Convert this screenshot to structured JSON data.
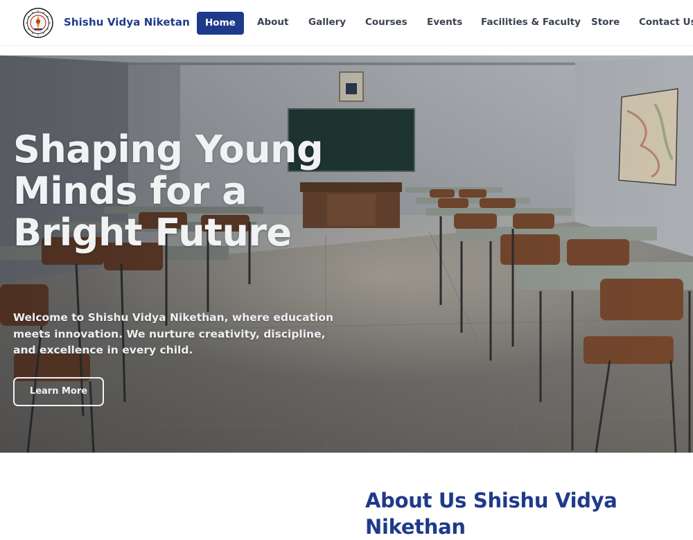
{
  "header": {
    "brand": "Shishu Vidya Niketan",
    "logo_icon": "school-emblem-icon",
    "nav": [
      {
        "label": "Home",
        "active": true
      },
      {
        "label": "About"
      },
      {
        "label": "Gallery"
      },
      {
        "label": "Courses"
      },
      {
        "label": "Events"
      },
      {
        "label": "Facilities & Faculty"
      },
      {
        "label": "Store"
      },
      {
        "label": "Contact Us"
      }
    ]
  },
  "hero": {
    "title": "Shaping Young Minds for a Bright Future",
    "subtitle": "Welcome to Shishu Vidya Nikethan, where education meets innovation. We nurture creativity, discipline, and excellence in every child.",
    "button_label": "Learn More"
  },
  "about": {
    "title": "About Us Shishu Vidya Nikethan"
  },
  "colors": {
    "brand_blue": "#1f3a8a",
    "nav_text": "#3a4250",
    "hero_text": "#f1f2f4"
  }
}
